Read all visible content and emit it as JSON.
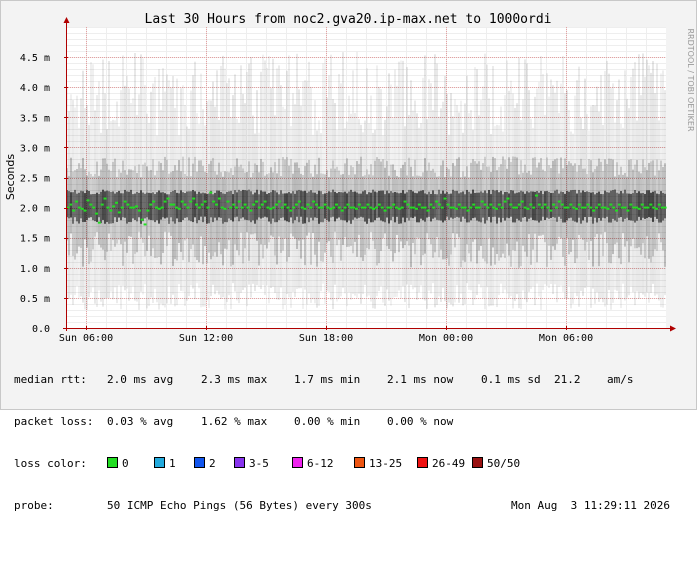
{
  "chart_data": {
    "type": "line",
    "title": "Last 30 Hours from noc2.gva20.ip-max.net to 1000ordi",
    "ylabel": "Seconds",
    "side_label": "RRDTOOL / TOBI OETIKER",
    "y_ticks": [
      "0.0",
      "0.5 m",
      "1.0 m",
      "1.5 m",
      "2.0 m",
      "2.5 m",
      "3.0 m",
      "3.5 m",
      "4.0 m",
      "4.5 m"
    ],
    "y_tick_values": [
      0,
      0.5,
      1.0,
      1.5,
      2.0,
      2.5,
      3.0,
      3.5,
      4.0,
      4.5
    ],
    "ylim": [
      0,
      5.0
    ],
    "y_unit": "ms",
    "x_range_hours": [
      0,
      30
    ],
    "x_ticks": [
      "Sun 06:00",
      "Sun 12:00",
      "Sun 18:00",
      "Mon 00:00",
      "Mon 06:00"
    ],
    "x_tick_hours": [
      1.0,
      7.0,
      13.0,
      19.0,
      25.0
    ],
    "grid": true,
    "series": [
      {
        "name": "median rtt",
        "color": "#22dd22",
        "values": [
          2.0,
          2.05,
          1.95,
          2.1,
          2.0,
          1.98,
          1.95,
          2.12,
          2.05,
          2.0,
          1.9,
          1.75,
          2.05,
          2.15,
          2.0,
          1.95,
          2.02,
          2.08,
          1.92,
          2.0,
          2.1,
          2.05,
          2.0,
          2.0,
          2.02,
          1.95,
          1.8,
          1.72,
          1.95,
          2.05,
          2.1,
          2.0,
          1.98,
          2.0,
          2.1,
          2.15,
          2.05,
          2.05,
          2.0,
          1.98,
          2.1,
          2.05,
          2.0,
          2.1,
          2.15,
          2.05,
          2.0,
          2.05,
          2.1,
          2.0,
          2.25,
          2.1,
          2.05,
          2.15,
          2.0,
          1.98,
          2.1,
          2.0,
          2.05,
          2.0,
          2.1,
          2.0,
          2.05,
          2.0,
          1.95,
          2.05,
          2.1,
          2.0,
          2.05,
          2.1,
          2.0,
          1.98,
          2.0,
          2.05,
          2.1,
          2.0,
          2.05,
          2.0,
          1.95,
          2.0,
          2.05,
          2.1,
          2.0,
          1.98,
          2.05,
          2.0,
          2.1,
          2.05,
          2.0,
          2.0,
          2.05,
          2.0,
          1.98,
          2.0,
          2.05,
          2.0,
          1.95,
          2.0,
          2.05,
          2.0,
          2.0,
          1.98,
          2.05,
          2.0,
          2.0,
          2.05,
          2.0,
          1.98,
          2.0,
          2.05,
          2.0,
          1.95,
          2.0,
          2.0,
          2.05,
          2.0,
          1.98,
          2.0,
          2.1,
          2.05,
          2.0,
          2.0,
          1.98,
          2.05,
          2.0,
          2.0,
          1.95,
          2.05,
          2.0,
          2.1,
          2.05,
          2.0,
          2.15,
          2.05,
          2.0,
          2.0,
          1.98,
          2.05,
          2.0,
          2.0,
          1.95,
          2.0,
          2.05,
          2.0,
          2.0,
          2.1,
          2.05,
          2.0,
          2.05,
          2.0,
          1.98,
          2.05,
          2.0,
          2.1,
          2.15,
          2.05,
          2.0,
          2.0,
          2.05,
          2.1,
          2.0,
          1.98,
          2.05,
          2.0,
          2.2,
          2.05,
          2.0,
          2.05,
          2.0,
          1.95,
          2.05,
          2.0,
          2.1,
          2.05,
          2.0,
          2.0,
          2.05,
          2.0,
          1.98,
          2.05,
          2.0,
          2.0,
          2.05,
          2.0,
          1.95,
          2.0,
          2.05,
          2.0,
          2.0,
          1.98,
          2.05,
          2.0,
          1.95,
          2.05,
          2.0,
          2.0,
          1.95,
          2.05,
          2.0,
          2.0,
          1.98,
          2.05,
          2.0,
          2.0,
          2.05,
          2.0,
          1.98,
          2.05,
          2.0,
          2.0
        ]
      }
    ],
    "smoke_band": {
      "color": "#000000",
      "outer_range": [
        0.3,
        3.2
      ],
      "inner_range": [
        1.6,
        2.5
      ]
    },
    "annotation_colors": {
      "axis_arrow": "#b00000",
      "grid": "#e6a0a0"
    }
  },
  "legend": {
    "median_rtt": {
      "label": "median rtt:",
      "avg": "2.0 ms avg",
      "max": "2.3 ms max",
      "min": "1.7 ms min",
      "now": "2.1 ms now",
      "sd": "0.1 ms sd",
      "am": "21.2",
      "am_unit": "am/s"
    },
    "packet_loss": {
      "label": "packet loss:",
      "avg": "0.03 % avg",
      "max": "1.62 % max",
      "min": "0.00 % min",
      "now": "0.00 % now"
    },
    "loss_color": {
      "label": "loss color:",
      "items": [
        {
          "label": "0",
          "color": "#22dd22"
        },
        {
          "label": "1",
          "color": "#22aadd"
        },
        {
          "label": "2",
          "color": "#1155ee"
        },
        {
          "label": "3-5",
          "color": "#8833ee"
        },
        {
          "label": "6-12",
          "color": "#ee22ee"
        },
        {
          "label": "13-25",
          "color": "#ee5511"
        },
        {
          "label": "26-49",
          "color": "#ee1111"
        },
        {
          "label": "50/50",
          "color": "#991111"
        }
      ]
    },
    "probe": {
      "label": "probe:",
      "text": "50 ICMP Echo Pings (56 Bytes) every 300s",
      "timestamp": "Mon Aug  3 11:29:11 2026"
    }
  }
}
